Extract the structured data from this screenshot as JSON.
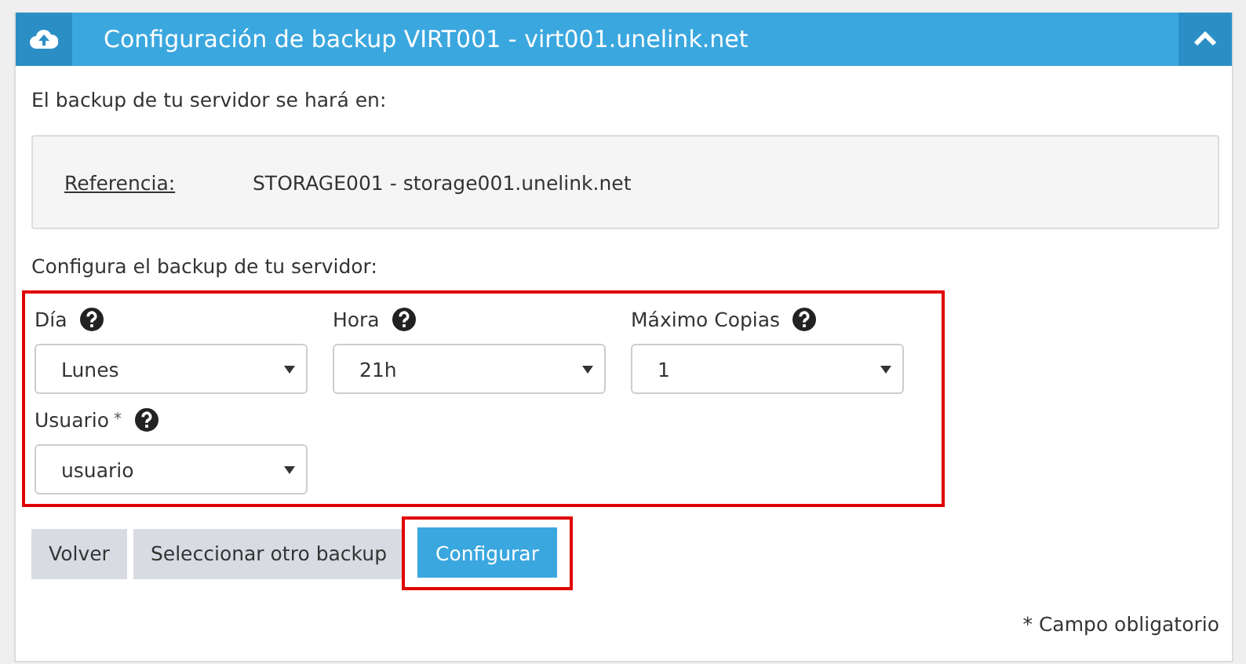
{
  "panel": {
    "title": "Configuración de backup VIRT001 - virt001.unelink.net",
    "expanded": true
  },
  "destination_text": "El backup de tu servidor se hará en:",
  "reference": {
    "label": "Referencia:",
    "value": "STORAGE001 - storage001.unelink.net"
  },
  "config_text": "Configura el backup de tu servidor:",
  "form": {
    "highlighted": true,
    "fields": [
      {
        "label": "Día",
        "value": "Lunes"
      },
      {
        "label": "Hora",
        "value": "21h"
      },
      {
        "label": "Máximo Copias",
        "value": "1"
      },
      {
        "label": "Usuario",
        "required_mark": "*",
        "value": "usuario"
      }
    ]
  },
  "buttons": [
    {
      "label": "Volver",
      "kind": "secondary",
      "highlighted": false
    },
    {
      "label": "Seleccionar otro backup",
      "kind": "secondary",
      "highlighted": false
    },
    {
      "label": "Configurar",
      "kind": "primary",
      "highlighted": true
    }
  ],
  "footnote": "* Campo obligatorio"
}
